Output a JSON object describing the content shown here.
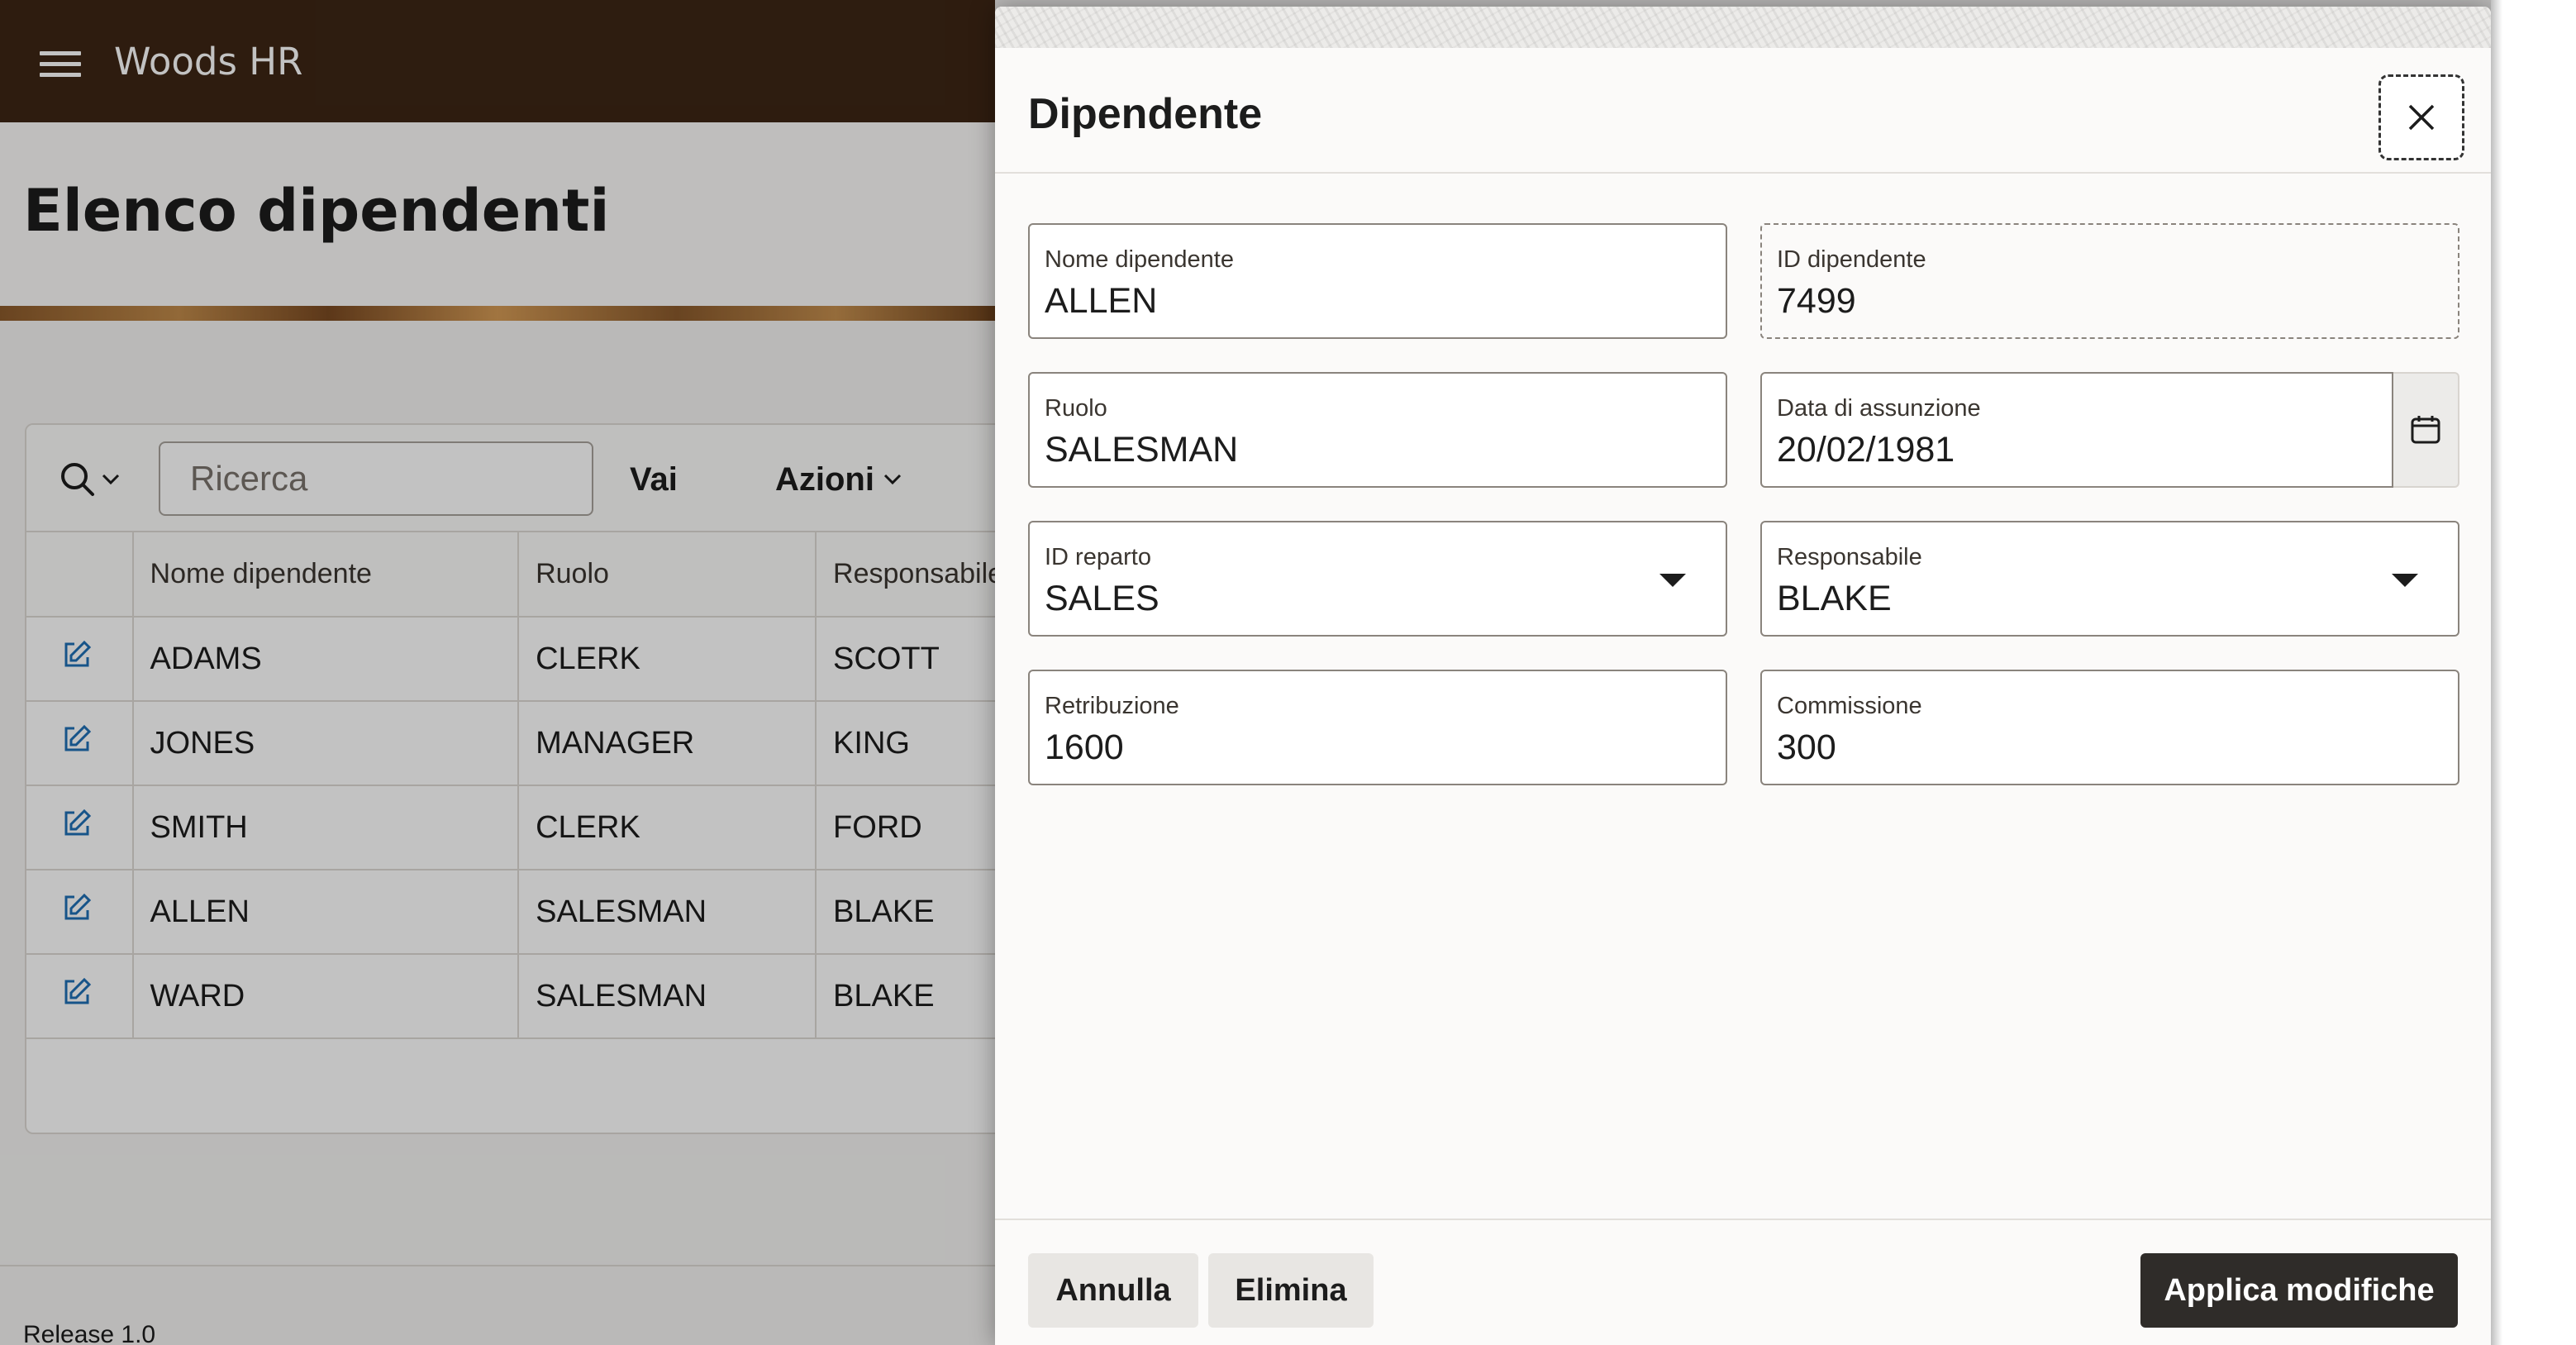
{
  "header": {
    "app_title": "Woods HR"
  },
  "page": {
    "title": "Elenco dipendenti"
  },
  "toolbar": {
    "search_placeholder": "Ricerca",
    "go_label": "Vai",
    "actions_label": "Azioni"
  },
  "table": {
    "columns": [
      "Nome dipendente",
      "Ruolo",
      "Responsabile"
    ],
    "rows": [
      {
        "name": "ADAMS",
        "role": "CLERK",
        "manager": "SCOTT"
      },
      {
        "name": "JONES",
        "role": "MANAGER",
        "manager": "KING"
      },
      {
        "name": "SMITH",
        "role": "CLERK",
        "manager": "FORD"
      },
      {
        "name": "ALLEN",
        "role": "SALESMAN",
        "manager": "BLAKE"
      },
      {
        "name": "WARD",
        "role": "SALESMAN",
        "manager": "BLAKE"
      }
    ]
  },
  "footer": {
    "release": "Release 1.0"
  },
  "dialog": {
    "title": "Dipendente",
    "fields": {
      "name": {
        "label": "Nome dipendente",
        "value": "ALLEN"
      },
      "id": {
        "label": "ID dipendente",
        "value": "7499"
      },
      "role": {
        "label": "Ruolo",
        "value": "SALESMAN"
      },
      "hire_date": {
        "label": "Data di assunzione",
        "value": "20/02/1981"
      },
      "dept": {
        "label": "ID reparto",
        "value": "SALES"
      },
      "manager": {
        "label": "Responsabile",
        "value": "BLAKE"
      },
      "salary": {
        "label": "Retribuzione",
        "value": "1600"
      },
      "commission": {
        "label": "Commissione",
        "value": "300"
      }
    },
    "buttons": {
      "cancel": "Annulla",
      "delete": "Elimina",
      "apply": "Applica modifiche"
    }
  },
  "colors": {
    "header_bg": "#3d2615",
    "primary_button": "#2f2c29"
  },
  "icons": {
    "menu": "hamburger-menu-icon",
    "search": "search-icon",
    "edit": "edit-icon",
    "calendar": "calendar-icon",
    "close": "close-icon"
  }
}
